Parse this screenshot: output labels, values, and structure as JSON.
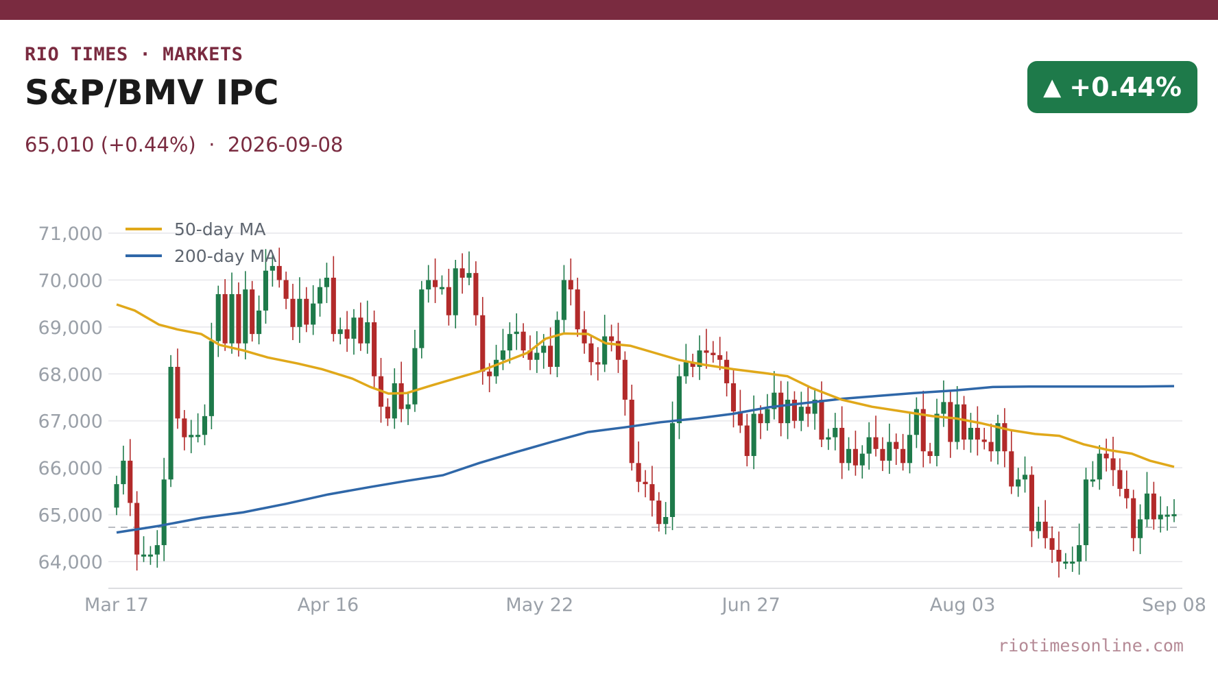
{
  "header": {
    "kicker": "RIO TIMES · MARKETS",
    "title": "S&P/BMV IPC",
    "price_line": "65,010 (+0.44%)",
    "separator": "·",
    "date": "2026-09-08"
  },
  "badge": {
    "arrow": "▲",
    "change": "+0.44%",
    "color": "#1e7a4a"
  },
  "footer": {
    "source": "riotimesonline.com"
  },
  "colors": {
    "up": "#1e7a4a",
    "down": "#b22a2a",
    "ma50": "#e0a81a",
    "ma200": "#2f67a8",
    "brand": "#7a2b40",
    "reference_line": "#b9bcc2"
  },
  "chart_data": {
    "type": "candlestick",
    "x_range": [
      "2026-03-17",
      "2026-09-08"
    ],
    "xticks": [
      "Mar 17",
      "Apr 16",
      "May 22",
      "Jun 27",
      "Aug 03",
      "Sep 08"
    ],
    "yticks": [
      64000,
      65000,
      66000,
      67000,
      68000,
      69000,
      70000,
      71000
    ],
    "ytick_labels": [
      "64,000",
      "65,000",
      "66,000",
      "67,000",
      "68,000",
      "69,000",
      "70,000",
      "71,000"
    ],
    "ylim": [
      63450,
      71300
    ],
    "reference_level": 64730,
    "grid": true,
    "legend_position": "top-left",
    "legend": [
      "50-day MA",
      "200-day MA"
    ],
    "close": [
      65650,
      66150,
      65250,
      64150,
      64150,
      64150,
      64350,
      65750,
      68150,
      67050,
      66650,
      66700,
      66700,
      67100,
      68700,
      69700,
      68650,
      69700,
      68650,
      69800,
      68850,
      69350,
      70200,
      70300,
      70000,
      69600,
      69000,
      69600,
      69050,
      69500,
      69850,
      70050,
      68850,
      68950,
      68750,
      69200,
      68650,
      69100,
      67950,
      67300,
      67050,
      67800,
      67250,
      67350,
      68550,
      69800,
      70000,
      69850,
      69850,
      69250,
      70250,
      70050,
      70150,
      69250,
      68050,
      67950,
      68300,
      68500,
      68850,
      68900,
      68500,
      68300,
      68450,
      68600,
      68150,
      69150,
      70000,
      69800,
      68950,
      68650,
      68250,
      68200,
      68800,
      68700,
      68300,
      67450,
      66100,
      65700,
      65650,
      65300,
      64800,
      64950,
      66950,
      67950,
      68250,
      68150,
      68500,
      68450,
      68400,
      68300,
      67800,
      67200,
      66900,
      66250,
      67150,
      66950,
      67250,
      67600,
      66950,
      67450,
      67000,
      67300,
      67150,
      67450,
      66600,
      66650,
      66850,
      66100,
      66400,
      66050,
      66300,
      66650,
      66400,
      66150,
      66550,
      66400,
      66100,
      66700,
      67250,
      66350,
      66250,
      67150,
      67400,
      66550,
      67350,
      66600,
      66850,
      66600,
      66550,
      66350,
      66950,
      66350,
      65600,
      65750,
      65850,
      64650,
      64850,
      64500,
      64250,
      64000,
      64000,
      64000,
      64350,
      65750,
      65750,
      66300,
      66200,
      65950,
      65550,
      65350,
      64500,
      64900,
      65450,
      64900,
      65000,
      65000,
      65010
    ],
    "ma50_label": "50-day MA",
    "ma50_points": [
      [
        "2026-03-17",
        69480
      ],
      [
        "2026-03-20",
        69350
      ],
      [
        "2026-03-24",
        69050
      ],
      [
        "2026-03-27",
        68950
      ],
      [
        "2026-03-31",
        68850
      ],
      [
        "2026-04-03",
        68620
      ],
      [
        "2026-04-07",
        68500
      ],
      [
        "2026-04-11",
        68350
      ],
      [
        "2026-04-16",
        68220
      ],
      [
        "2026-04-20",
        68100
      ],
      [
        "2026-04-25",
        67900
      ],
      [
        "2026-04-28",
        67720
      ],
      [
        "2026-05-01",
        67580
      ],
      [
        "2026-05-04",
        67590
      ],
      [
        "2026-05-08",
        67750
      ],
      [
        "2026-05-12",
        67900
      ],
      [
        "2026-05-16",
        68050
      ],
      [
        "2026-05-20",
        68250
      ],
      [
        "2026-05-24",
        68450
      ],
      [
        "2026-05-27",
        68750
      ],
      [
        "2026-05-30",
        68860
      ],
      [
        "2026-06-03",
        68850
      ],
      [
        "2026-06-06",
        68650
      ],
      [
        "2026-06-10",
        68600
      ],
      [
        "2026-06-14",
        68450
      ],
      [
        "2026-06-18",
        68300
      ],
      [
        "2026-06-22",
        68200
      ],
      [
        "2026-06-27",
        68100
      ],
      [
        "2026-07-02",
        68020
      ],
      [
        "2026-07-06",
        67950
      ],
      [
        "2026-07-10",
        67700
      ],
      [
        "2026-07-15",
        67450
      ],
      [
        "2026-07-20",
        67300
      ],
      [
        "2026-07-25",
        67200
      ],
      [
        "2026-07-30",
        67100
      ],
      [
        "2026-08-03",
        67050
      ],
      [
        "2026-08-07",
        66950
      ],
      [
        "2026-08-12",
        66800
      ],
      [
        "2026-08-16",
        66720
      ],
      [
        "2026-08-20",
        66680
      ],
      [
        "2026-08-24",
        66500
      ],
      [
        "2026-08-28",
        66380
      ],
      [
        "2026-09-01",
        66300
      ],
      [
        "2026-09-04",
        66150
      ],
      [
        "2026-09-08",
        66020
      ]
    ],
    "ma200_label": "200-day MA",
    "ma200_points": [
      [
        "2026-03-17",
        64620
      ],
      [
        "2026-03-24",
        64760
      ],
      [
        "2026-03-31",
        64930
      ],
      [
        "2026-04-07",
        65050
      ],
      [
        "2026-04-14",
        65230
      ],
      [
        "2026-04-21",
        65430
      ],
      [
        "2026-04-28",
        65590
      ],
      [
        "2026-05-04",
        65720
      ],
      [
        "2026-05-10",
        65840
      ],
      [
        "2026-05-16",
        66100
      ],
      [
        "2026-05-22",
        66330
      ],
      [
        "2026-05-28",
        66550
      ],
      [
        "2026-06-03",
        66760
      ],
      [
        "2026-06-09",
        66860
      ],
      [
        "2026-06-15",
        66970
      ],
      [
        "2026-06-21",
        67050
      ],
      [
        "2026-06-27",
        67150
      ],
      [
        "2026-07-03",
        67290
      ],
      [
        "2026-07-09",
        67380
      ],
      [
        "2026-07-15",
        67470
      ],
      [
        "2026-07-21",
        67530
      ],
      [
        "2026-07-27",
        67590
      ],
      [
        "2026-08-03",
        67650
      ],
      [
        "2026-08-09",
        67720
      ],
      [
        "2026-08-15",
        67730
      ],
      [
        "2026-08-21",
        67730
      ],
      [
        "2026-08-27",
        67730
      ],
      [
        "2026-09-02",
        67730
      ],
      [
        "2026-09-08",
        67740
      ]
    ]
  }
}
